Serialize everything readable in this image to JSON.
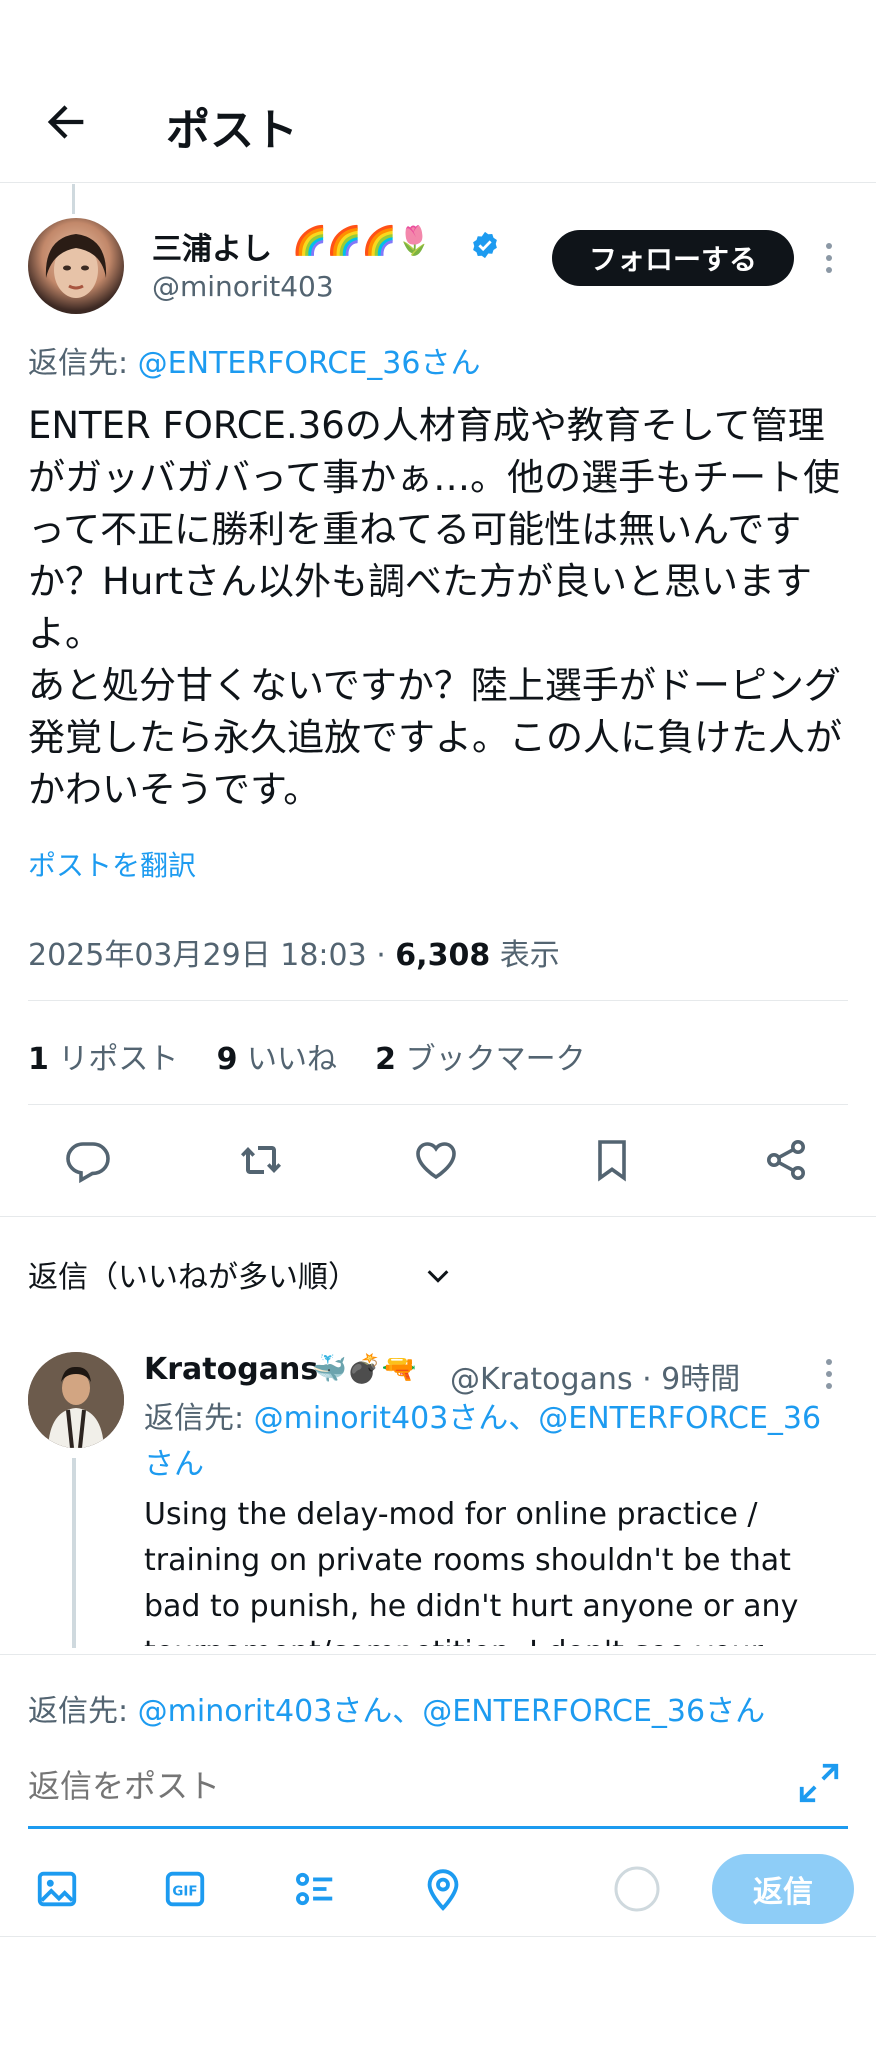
{
  "header": {
    "title": "ポスト"
  },
  "post": {
    "author_name": "三浦よし",
    "author_emoji": "🌈🌈🌈🌷",
    "author_handle": "@minorit403",
    "follow_label": "フォローする",
    "reply_to_prefix": "返信先: ",
    "reply_to_handle": "@ENTERFORCE_36さん",
    "body": "ENTER FORCE.36の人材育成や教育そして管理がガッバガバって事かぁ…。他の選手もチート使って不正に勝利を重ねてる可能性は無いんですか？Hurtさん以外も調べた方が良いと思いますよ。\nあと処分甘くないですか？陸上選手がドーピング発覚したら永久追放ですよ。この人に負けた人がかわいそうです。",
    "translate_label": "ポストを翻訳",
    "datetime": "2025年03月29日 18:03",
    "dot": " · ",
    "views_count": "6,308",
    "views_label": " 表示",
    "reposts_count": "1",
    "reposts_label": " リポスト",
    "likes_count": "9",
    "likes_label": " いいね",
    "bookmarks_count": "2",
    "bookmarks_label": " ブックマーク"
  },
  "replies_sort_label": "返信（いいねが多い順）",
  "reply": {
    "name": "Kratogans",
    "emoji": "🐳💣🔫",
    "handle_time": "@Kratogans · 9時間",
    "reply_to_prefix": "返信先: ",
    "reply_to_handles": "@minorit403さん、@ENTERFORCE_36さん",
    "body": "Using the delay-mod for online practice / training on private rooms shouldn't be that bad to punish, he didn't hurt anyone or any tournament/competition. I don't see your"
  },
  "composer": {
    "reply_to_prefix": "返信先: ",
    "reply_to_handles": "@minorit403さん、@ENTERFORCE_36さん",
    "placeholder": "返信をポスト",
    "submit_label": "返信"
  },
  "icons": [
    "back-arrow-icon",
    "verified-badge-icon",
    "more-icon",
    "reply-icon",
    "repost-icon",
    "like-icon",
    "bookmark-icon",
    "share-icon",
    "chevron-down-icon",
    "expand-icon",
    "image-icon",
    "gif-icon",
    "poll-icon",
    "location-icon",
    "progress-circle-icon"
  ],
  "colors": {
    "accent": "#1d9bf0",
    "text": "#0f1419",
    "secondary": "#536471",
    "submit_disabled": "#8ecdf7"
  }
}
